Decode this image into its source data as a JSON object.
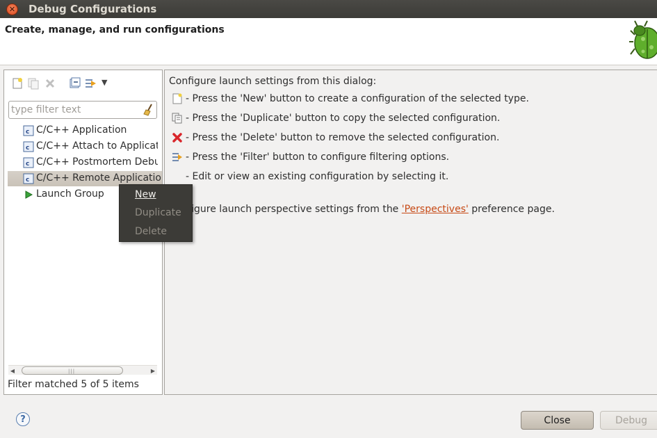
{
  "window": {
    "title": "Debug Configurations"
  },
  "header": {
    "title": "Create, manage, and run configurations"
  },
  "left_panel": {
    "toolbar": {
      "icons": [
        "new-configuration-icon",
        "duplicate-icon",
        "delete-icon",
        "collapse-all-icon",
        "filter-icon",
        "view-menu-icon"
      ]
    },
    "filter": {
      "placeholder": "type filter text",
      "value": ""
    },
    "tree": [
      {
        "label": "C/C++ Application",
        "icon": "c-app-icon",
        "selected": false
      },
      {
        "label": "C/C++ Attach to Application",
        "icon": "c-app-icon",
        "selected": false
      },
      {
        "label": "C/C++ Postmortem Debugger",
        "icon": "c-app-icon",
        "selected": false
      },
      {
        "label": "C/C++ Remote Application",
        "icon": "c-app-icon",
        "selected": true
      },
      {
        "label": "Launch Group",
        "icon": "launch-group-icon",
        "selected": false
      }
    ],
    "status": "Filter matched 5 of 5 items"
  },
  "context_menu": {
    "items": [
      {
        "label": "New",
        "enabled": true
      },
      {
        "label": "Duplicate",
        "enabled": false
      },
      {
        "label": "Delete",
        "enabled": false
      }
    ]
  },
  "right_panel": {
    "intro": "Configure launch settings from this dialog:",
    "lines": [
      {
        "icon": "new-configuration-icon",
        "text": "- Press the 'New' button to create a configuration of the selected type."
      },
      {
        "icon": "duplicate-icon",
        "text": "- Press the 'Duplicate' button to copy the selected configuration."
      },
      {
        "icon": "delete-icon",
        "text": "- Press the 'Delete' button to remove the selected configuration."
      },
      {
        "icon": "filter-icon",
        "text": "- Press the 'Filter' button to configure filtering options."
      },
      {
        "icon": "",
        "text": "- Edit or view an existing configuration by selecting it."
      }
    ],
    "perspectives_prefix": "Configure launch perspective settings from the",
    "perspectives_link": "'Perspectives'",
    "perspectives_suffix": "preference page."
  },
  "buttons": {
    "help": "?",
    "close": "Close",
    "debug": "Debug"
  },
  "colors": {
    "link": "#c74a16",
    "titlebar": "#3c3b37",
    "menu_bg": "#3c3b37",
    "error_x": "#d9262b"
  }
}
